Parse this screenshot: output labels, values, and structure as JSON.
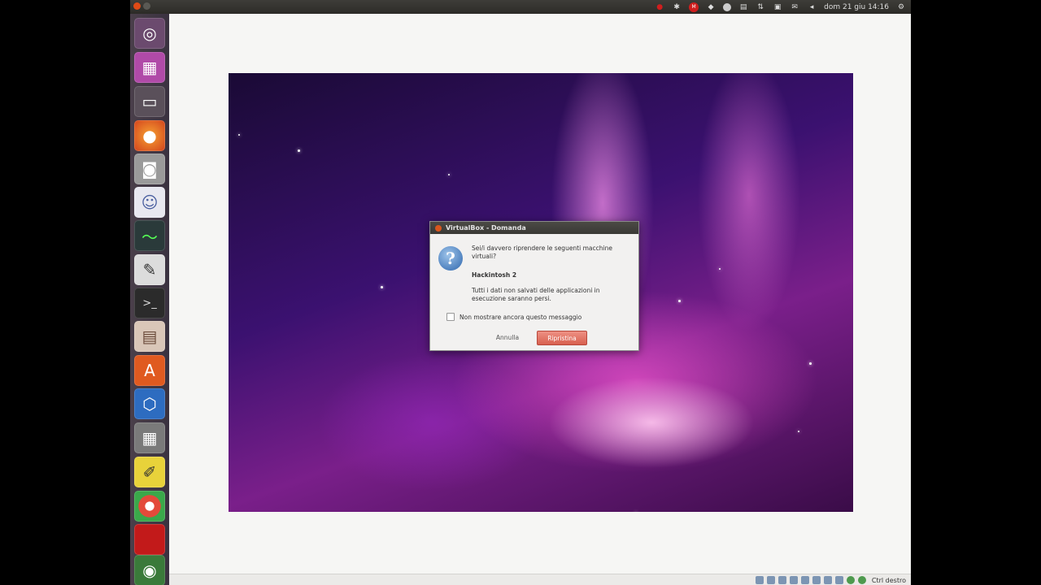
{
  "top_panel": {
    "clock": "dom 21 giu 14:16",
    "tray_icons": [
      "record-icon",
      "bluetooth-icon",
      "mail-badge-icon",
      "dropbox-icon",
      "chat-icon",
      "keyboard-icon",
      "network-icon",
      "battery-icon",
      "mail-icon",
      "volume-icon",
      "clock",
      "settings-icon"
    ],
    "mail_badge": "M"
  },
  "launcher": {
    "items": [
      "ubuntu-dash",
      "workspace-switcher",
      "files-bar",
      "firefox",
      "screenshot",
      "pidgin",
      "system-monitor",
      "text-editor",
      "terminal",
      "file-manager",
      "software-center",
      "virtualbox",
      "calculator",
      "notes",
      "chrome",
      "red-app",
      "disk-utility"
    ]
  },
  "dialog": {
    "title": "VirtualBox - Domanda",
    "question": "Sei/i davvero riprendere le seguenti macchine virtuali?",
    "machine": "Hackintosh 2",
    "warning": "Tutti i dati non salvati delle applicazioni in esecuzione saranno persi.",
    "checkbox_label": "Non mostrare ancora questo messaggio",
    "cancel_label": "Annulla",
    "ok_label": "Ripristina"
  },
  "statusbar": {
    "host_key": "Ctrl destro"
  },
  "colors": {
    "launcher_bg": "#3a3240",
    "panel_bg": "#2c2b27",
    "ok_button": "#d8604f"
  }
}
